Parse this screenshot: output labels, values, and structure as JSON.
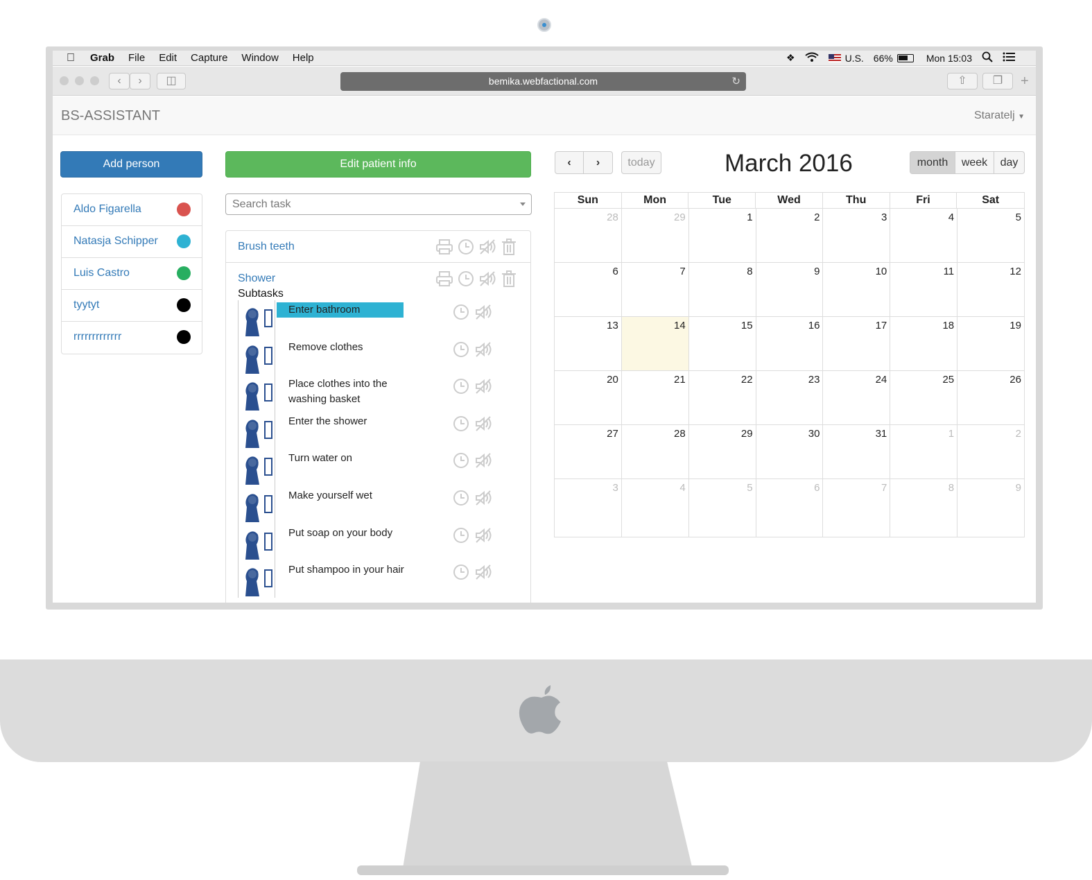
{
  "menubar": {
    "app": "Grab",
    "items": [
      "File",
      "Edit",
      "Capture",
      "Window",
      "Help"
    ],
    "input_source": "U.S.",
    "battery": "66%",
    "clock": "Mon 15:03"
  },
  "browser": {
    "url": "bemika.webfactional.com"
  },
  "navbar": {
    "brand": "BS-ASSISTANT",
    "user": "Staratelj"
  },
  "left": {
    "add_person_label": "Add person",
    "people": [
      {
        "name": "Aldo Figarella",
        "color": "#d9534f"
      },
      {
        "name": "Natasja Schipper",
        "color": "#2eb2d3"
      },
      {
        "name": "Luis Castro",
        "color": "#27ae60"
      },
      {
        "name": "tyytyt",
        "color": "#000000"
      },
      {
        "name": "rrrrrrrrrrrrr",
        "color": "#000000"
      }
    ]
  },
  "middle": {
    "edit_patient_label": "Edit patient info",
    "search_placeholder": "Search task",
    "tasks": [
      {
        "name": "Brush teeth"
      },
      {
        "name": "Shower"
      }
    ],
    "subtasks_label": "Subtasks",
    "subtasks": [
      {
        "text": "Enter bathroom",
        "highlight": true
      },
      {
        "text": "Remove clothes"
      },
      {
        "text": "Place clothes into the washing basket"
      },
      {
        "text": "Enter the shower"
      },
      {
        "text": "Turn water on"
      },
      {
        "text": "Make yourself wet"
      },
      {
        "text": "Put soap on your body"
      },
      {
        "text": "Put shampoo in your hair"
      }
    ],
    "highlight_color": "#2eb2d3"
  },
  "calendar": {
    "title": "March 2016",
    "today_label": "today",
    "prev_label": "‹",
    "next_label": "›",
    "views": [
      "month",
      "week",
      "day"
    ],
    "active_view": "month",
    "weekdays": [
      "Sun",
      "Mon",
      "Tue",
      "Wed",
      "Thu",
      "Fri",
      "Sat"
    ],
    "weeks": [
      [
        {
          "d": "28",
          "o": true
        },
        {
          "d": "29",
          "o": true
        },
        {
          "d": "1"
        },
        {
          "d": "2"
        },
        {
          "d": "3"
        },
        {
          "d": "4"
        },
        {
          "d": "5"
        }
      ],
      [
        {
          "d": "6"
        },
        {
          "d": "7"
        },
        {
          "d": "8"
        },
        {
          "d": "9"
        },
        {
          "d": "10"
        },
        {
          "d": "11"
        },
        {
          "d": "12"
        }
      ],
      [
        {
          "d": "13"
        },
        {
          "d": "14",
          "t": true
        },
        {
          "d": "15"
        },
        {
          "d": "16"
        },
        {
          "d": "17"
        },
        {
          "d": "18"
        },
        {
          "d": "19"
        }
      ],
      [
        {
          "d": "20"
        },
        {
          "d": "21"
        },
        {
          "d": "22"
        },
        {
          "d": "23"
        },
        {
          "d": "24"
        },
        {
          "d": "25"
        },
        {
          "d": "26"
        }
      ],
      [
        {
          "d": "27"
        },
        {
          "d": "28"
        },
        {
          "d": "29"
        },
        {
          "d": "30"
        },
        {
          "d": "31"
        },
        {
          "d": "1",
          "o": true
        },
        {
          "d": "2",
          "o": true
        }
      ],
      [
        {
          "d": "3",
          "o": true
        },
        {
          "d": "4",
          "o": true
        },
        {
          "d": "5",
          "o": true
        },
        {
          "d": "6",
          "o": true
        },
        {
          "d": "7",
          "o": true
        },
        {
          "d": "8",
          "o": true
        },
        {
          "d": "9",
          "o": true
        }
      ]
    ]
  }
}
